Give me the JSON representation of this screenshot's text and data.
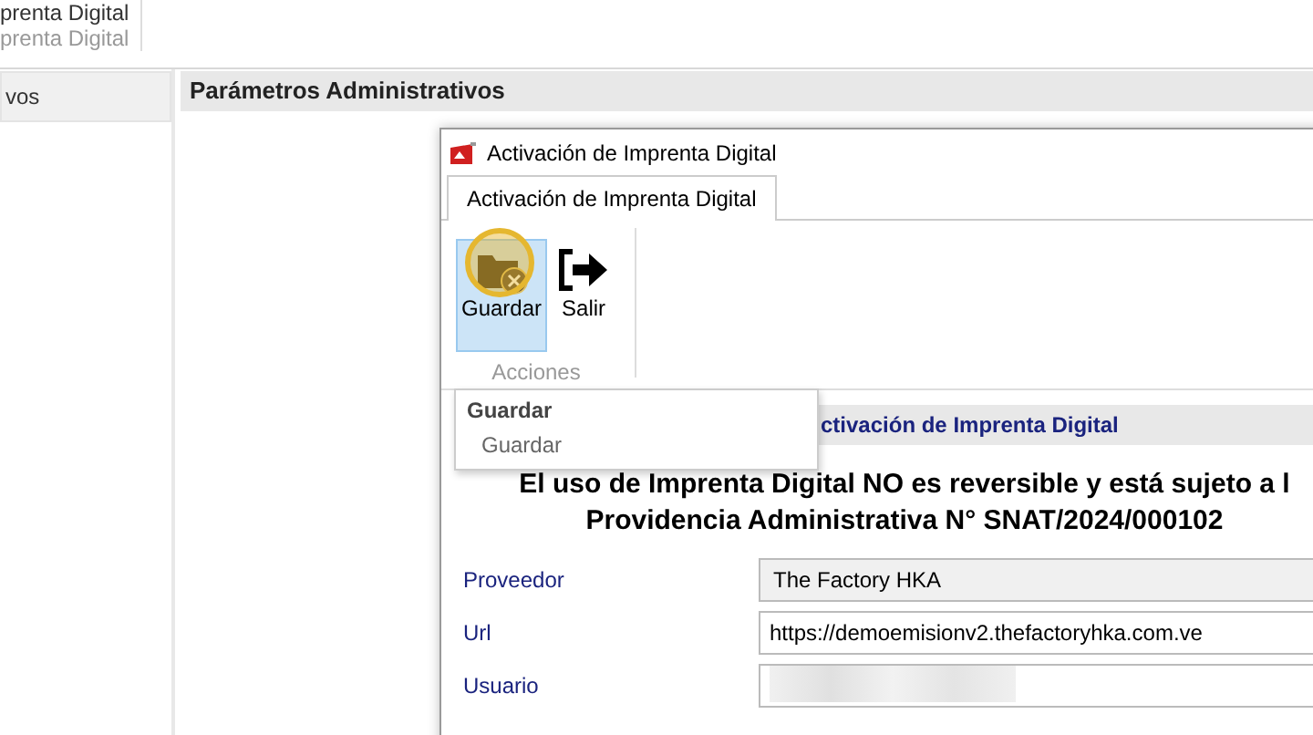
{
  "top_bar": {
    "title": "prenta Digital",
    "subtitle": "prenta Digital"
  },
  "sidebar": {
    "items": [
      {
        "label": "vos",
        "selected": true
      }
    ]
  },
  "section": {
    "title": "Parámetros Administrativos"
  },
  "dialog": {
    "title": "Activación de Imprenta Digital",
    "tabs": [
      {
        "label": "Activación de Imprenta Digital",
        "selected": true
      }
    ],
    "ribbon": {
      "group": "Acciones",
      "buttons": [
        {
          "label": "Guardar",
          "kind": "save",
          "selected": true
        },
        {
          "label": "Salir",
          "kind": "exit",
          "selected": false
        }
      ]
    },
    "tooltip": {
      "title": "Guardar",
      "text": "Guardar"
    },
    "panel": {
      "title": "ctivación de Imprenta Digital",
      "notice": [
        "El uso de Imprenta Digital NO es reversible y está sujeto a l",
        "Providencia Administrativa N° SNAT/2024/000102"
      ],
      "fields": [
        {
          "label": "Proveedor",
          "value": "The Factory HKA",
          "kind": "readonly"
        },
        {
          "label": "Url",
          "value": "https://demoemisionv2.thefactoryhka.com.ve",
          "kind": "text"
        },
        {
          "label": "Usuario",
          "kind": "hidden"
        }
      ]
    }
  }
}
